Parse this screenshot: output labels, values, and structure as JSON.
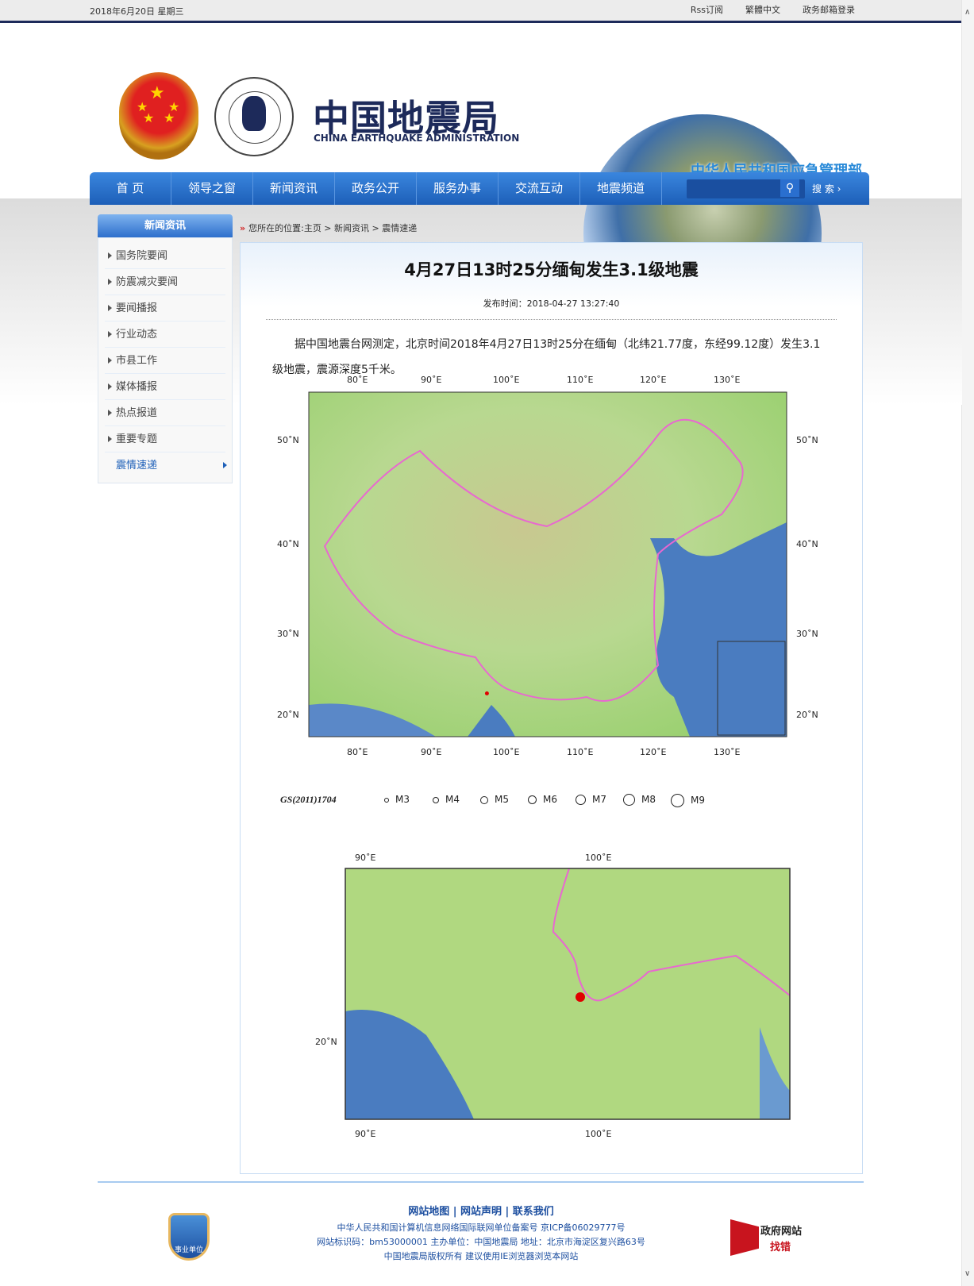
{
  "topbar": {
    "date": "2018年6月20日  星期三",
    "links": [
      "Rss订阅",
      "繁體中文",
      "政务邮箱登录"
    ]
  },
  "header": {
    "title_cn": "中国地震局",
    "title_en": "CHINA EARTHQUAKE ADMINISTRATION",
    "seal_text": "CHINA EARTHQUAKE ADMINISTRATION 中国地震局",
    "ministry": "中华人民共和国应急管理部"
  },
  "nav": {
    "items": [
      "首  页",
      "领导之窗",
      "新闻资讯",
      "政务公开",
      "服务办事",
      "交流互动",
      "地震频道"
    ],
    "search_placeholder": "",
    "search_label": "搜  索 ›"
  },
  "sidebar": {
    "title": "新闻资讯",
    "items": [
      "国务院要闻",
      "防震减灾要闻",
      "要闻播报",
      "行业动态",
      "市县工作",
      "媒体播报",
      "热点报道",
      "重要专题",
      "震情速递"
    ],
    "active": "震情速递"
  },
  "breadcrumb": "您所在的位置:主页 > 新闻资讯 > 震情速递",
  "article": {
    "title": "4月27日13时25分缅甸发生3.1级地震",
    "published": "发布时间：2018-04-27  13:27:40",
    "body": "据中国地震台网测定，北京时间2018年4月27日13时25分在缅甸（北纬21.77度，东经99.12度）发生3.1级地震，震源深度5千米。"
  },
  "map1": {
    "x_ticks": [
      "80˚E",
      "90˚E",
      "100˚E",
      "110˚E",
      "120˚E",
      "130˚E"
    ],
    "y_ticks": [
      "50˚N",
      "40˚N",
      "30˚N",
      "20˚N"
    ],
    "map_number": "GS(2011)1704",
    "legend": [
      "M3",
      "M4",
      "M5",
      "M6",
      "M7",
      "M8",
      "M9"
    ],
    "epicenter": {
      "lat": 21.77,
      "lon": 99.12
    },
    "colors": {
      "land": "#b8d890",
      "sea": "#4a7cc0",
      "border": "#e868d0",
      "epicenter": "#e00000"
    }
  },
  "map2": {
    "x_ticks": [
      "90˚E",
      "100˚E"
    ],
    "y_ticks": [
      "20˚N"
    ]
  },
  "footer": {
    "links": "网站地图 | 网站声明 | 联系我们",
    "lines": [
      "中华人民共和国计算机信息网络国际联网单位备案号 京ICP备06029777号",
      "网站标识码：bm53000001 主办单位：中国地震局 地址：北京市海淀区复兴路63号",
      "中国地震局版权所有 建议使用IE浏览器浏览本网站"
    ],
    "badge": "事业单位",
    "jiucuo_1": "政府网站",
    "jiucuo_2": "找错"
  }
}
